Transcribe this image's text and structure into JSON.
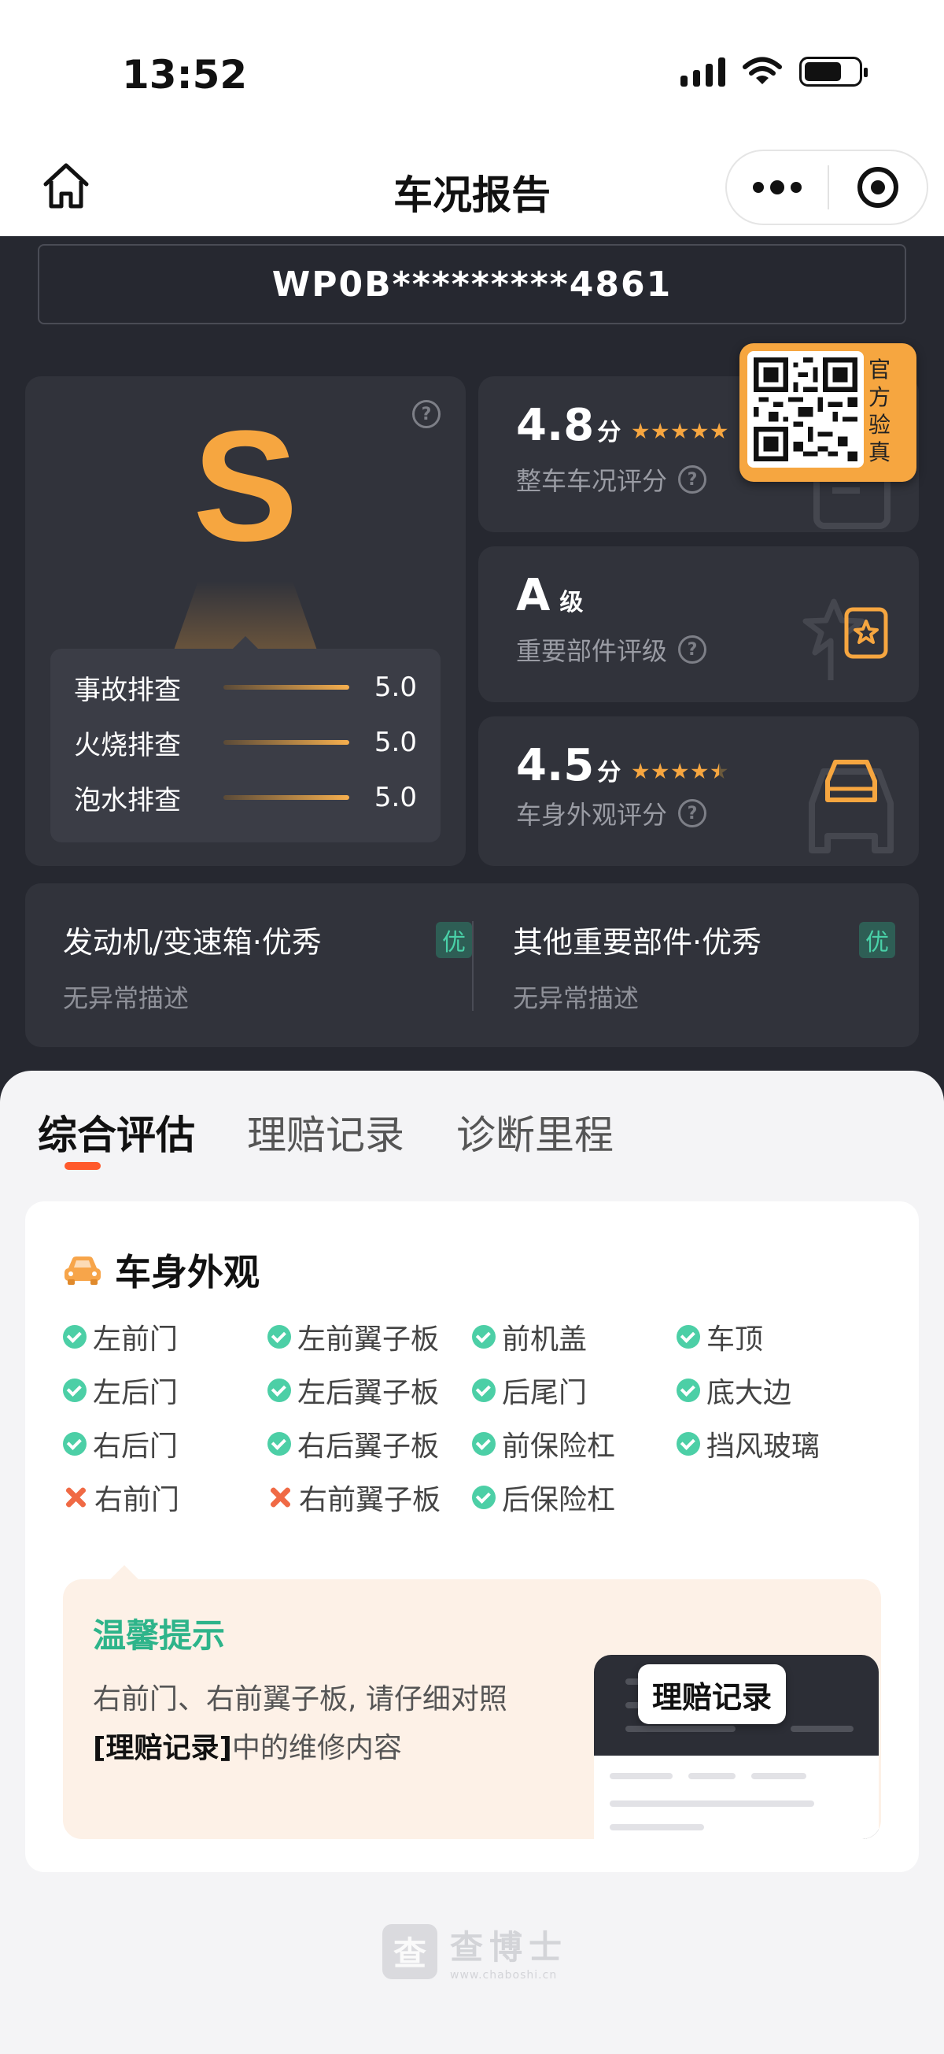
{
  "status_bar": {
    "time": "13:52"
  },
  "nav": {
    "title": "车况报告"
  },
  "vin": "WP0B*********4861",
  "grade": {
    "letter": "S",
    "checks": [
      {
        "label": "事故排查",
        "value": "5.0"
      },
      {
        "label": "火烧排查",
        "value": "5.0"
      },
      {
        "label": "泡水排查",
        "value": "5.0"
      }
    ]
  },
  "scores": {
    "overall": {
      "num": "4.8",
      "unit": "分",
      "label": "整车车况评分",
      "stars": 5
    },
    "parts": {
      "num": "A",
      "unit": "级",
      "label": "重要部件评级"
    },
    "exterior": {
      "num": "4.5",
      "unit": "分",
      "label": "车身外观评分",
      "stars": 4.5
    }
  },
  "qr_badge": {
    "text": [
      "官",
      "方",
      "验",
      "真"
    ]
  },
  "performance": [
    {
      "title": "发动机/变速箱·优秀",
      "badge": "优",
      "desc": "无异常描述"
    },
    {
      "title": "其他重要部件·优秀",
      "badge": "优",
      "desc": "无异常描述"
    }
  ],
  "tabs": [
    "综合评估",
    "理赔记录",
    "诊断里程"
  ],
  "exterior_section": {
    "title": "车身外观",
    "items": [
      {
        "label": "左前门",
        "status": "ok"
      },
      {
        "label": "左前翼子板",
        "status": "ok"
      },
      {
        "label": "前机盖",
        "status": "ok"
      },
      {
        "label": "车顶",
        "status": "ok"
      },
      {
        "label": "左后门",
        "status": "ok"
      },
      {
        "label": "左后翼子板",
        "status": "ok"
      },
      {
        "label": "后尾门",
        "status": "ok"
      },
      {
        "label": "底大边",
        "status": "ok"
      },
      {
        "label": "右后门",
        "status": "ok"
      },
      {
        "label": "右后翼子板",
        "status": "ok"
      },
      {
        "label": "前保险杠",
        "status": "ok"
      },
      {
        "label": "挡风玻璃",
        "status": "ok"
      },
      {
        "label": "右前门",
        "status": "repair"
      },
      {
        "label": "右前翼子板",
        "status": "repair"
      },
      {
        "label": "后保险杠",
        "status": "ok"
      }
    ]
  },
  "tip": {
    "title": "温馨提示",
    "text_before": "右前门、右前翼子板, 请仔细对照",
    "text_bold": "[理赔记录]",
    "text_after": "中的维修内容",
    "image_label": "理赔记录"
  },
  "footer": {
    "brand": "查博士",
    "url": "www.chaboshi.cn",
    "logo_char": "查"
  },
  "colors": {
    "accent": "#f6a640",
    "dark_bg": "#262830",
    "ok": "#4ccfa6",
    "repair": "#f06a45",
    "tab_underline": "#ff5a2c"
  }
}
